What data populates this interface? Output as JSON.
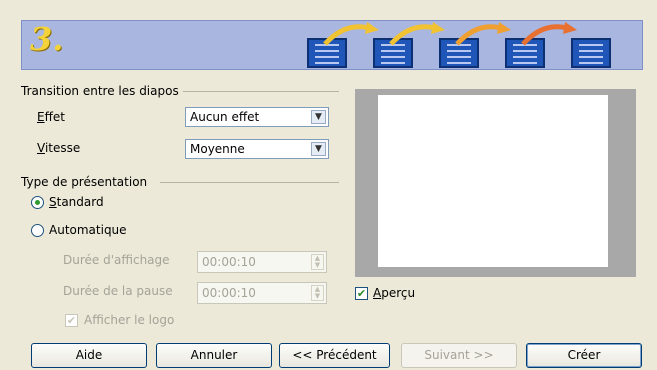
{
  "banner": {
    "step": "3."
  },
  "transition": {
    "group_label": "Transition entre les diapos",
    "effect_label": "Effet",
    "effect_value": "Aucun effet",
    "speed_label": "Vitesse",
    "speed_value": "Moyenne"
  },
  "presentation": {
    "group_label": "Type de présentation",
    "standard_label": "Standard",
    "automatic_label": "Automatique",
    "selected": "Standard",
    "duration_label": "Durée d'affichage",
    "duration_value": "00:00:10",
    "pause_label": "Durée de la pause",
    "pause_value": "00:00:10",
    "logo_label": "Afficher le logo"
  },
  "preview": {
    "checkbox_label": "Aperçu",
    "checked": true
  },
  "buttons": {
    "help": "Aide",
    "cancel": "Annuler",
    "previous": "<< Précédent",
    "next": "Suivant >>",
    "create": "Créer"
  }
}
